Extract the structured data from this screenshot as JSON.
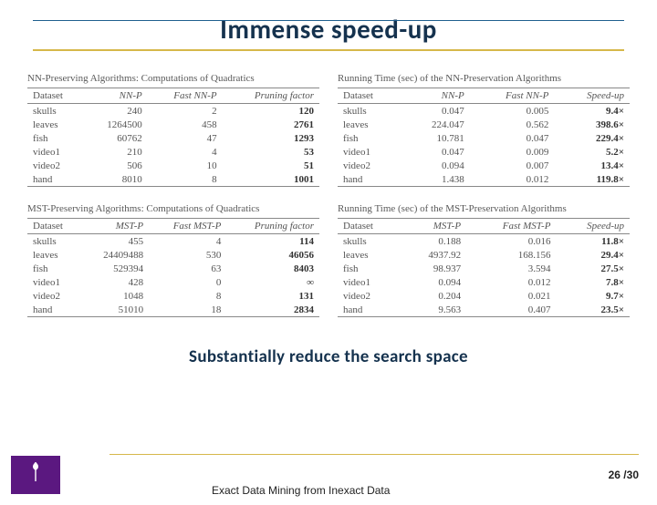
{
  "title": "Immense speed-up",
  "subtitle": "Substantially reduce the search space",
  "footer_title": "Exact Data Mining from Inexact Data",
  "pageno": "26 /30",
  "panels": {
    "nn_quad": {
      "title": "NN-Preserving Algorithms: Computations of Quadratics",
      "headers": [
        "Dataset",
        "NN-P",
        "Fast NN-P",
        "Pruning factor"
      ],
      "rows": [
        [
          "skulls",
          "240",
          "2",
          "120"
        ],
        [
          "leaves",
          "1264500",
          "458",
          "2761"
        ],
        [
          "fish",
          "60762",
          "47",
          "1293"
        ],
        [
          "video1",
          "210",
          "4",
          "53"
        ],
        [
          "video2",
          "506",
          "10",
          "51"
        ],
        [
          "hand",
          "8010",
          "8",
          "1001"
        ]
      ]
    },
    "nn_time": {
      "title": "Running Time (sec) of the NN-Preservation Algorithms",
      "headers": [
        "Dataset",
        "NN-P",
        "Fast NN-P",
        "Speed-up"
      ],
      "rows": [
        [
          "skulls",
          "0.047",
          "0.005",
          "9.4×"
        ],
        [
          "leaves",
          "224.047",
          "0.562",
          "398.6×"
        ],
        [
          "fish",
          "10.781",
          "0.047",
          "229.4×"
        ],
        [
          "video1",
          "0.047",
          "0.009",
          "5.2×"
        ],
        [
          "video2",
          "0.094",
          "0.007",
          "13.4×"
        ],
        [
          "hand",
          "1.438",
          "0.012",
          "119.8×"
        ]
      ]
    },
    "mst_quad": {
      "title": "MST-Preserving Algorithms: Computations of Quadratics",
      "headers": [
        "Dataset",
        "MST-P",
        "Fast MST-P",
        "Pruning factor"
      ],
      "rows": [
        [
          "skulls",
          "455",
          "4",
          "114"
        ],
        [
          "leaves",
          "24409488",
          "530",
          "46056"
        ],
        [
          "fish",
          "529394",
          "63",
          "8403"
        ],
        [
          "video1",
          "428",
          "0",
          "∞"
        ],
        [
          "video2",
          "1048",
          "8",
          "131"
        ],
        [
          "hand",
          "51010",
          "18",
          "2834"
        ]
      ]
    },
    "mst_time": {
      "title": "Running Time (sec) of the MST-Preservation Algorithms",
      "headers": [
        "Dataset",
        "MST-P",
        "Fast MST-P",
        "Speed-up"
      ],
      "rows": [
        [
          "skulls",
          "0.188",
          "0.016",
          "11.8×"
        ],
        [
          "leaves",
          "4937.92",
          "168.156",
          "29.4×"
        ],
        [
          "fish",
          "98.937",
          "3.594",
          "27.5×"
        ],
        [
          "video1",
          "0.094",
          "0.012",
          "7.8×"
        ],
        [
          "video2",
          "0.204",
          "0.021",
          "9.7×"
        ],
        [
          "hand",
          "9.563",
          "0.407",
          "23.5×"
        ]
      ]
    }
  },
  "chart_data": [
    {
      "type": "table",
      "title": "NN-Preserving Algorithms: Computations of Quadratics",
      "columns": [
        "Dataset",
        "NN-P",
        "Fast NN-P",
        "Pruning factor"
      ],
      "rows": [
        [
          "skulls",
          240,
          2,
          120
        ],
        [
          "leaves",
          1264500,
          458,
          2761
        ],
        [
          "fish",
          60762,
          47,
          1293
        ],
        [
          "video1",
          210,
          4,
          53
        ],
        [
          "video2",
          506,
          10,
          51
        ],
        [
          "hand",
          8010,
          8,
          1001
        ]
      ]
    },
    {
      "type": "table",
      "title": "Running Time (sec) of the NN-Preservation Algorithms",
      "columns": [
        "Dataset",
        "NN-P",
        "Fast NN-P",
        "Speed-up"
      ],
      "rows": [
        [
          "skulls",
          0.047,
          0.005,
          9.4
        ],
        [
          "leaves",
          224.047,
          0.562,
          398.6
        ],
        [
          "fish",
          10.781,
          0.047,
          229.4
        ],
        [
          "video1",
          0.047,
          0.009,
          5.2
        ],
        [
          "video2",
          0.094,
          0.007,
          13.4
        ],
        [
          "hand",
          1.438,
          0.012,
          119.8
        ]
      ]
    },
    {
      "type": "table",
      "title": "MST-Preserving Algorithms: Computations of Quadratics",
      "columns": [
        "Dataset",
        "MST-P",
        "Fast MST-P",
        "Pruning factor"
      ],
      "rows": [
        [
          "skulls",
          455,
          4,
          114
        ],
        [
          "leaves",
          24409488,
          530,
          46056
        ],
        [
          "fish",
          529394,
          63,
          8403
        ],
        [
          "video1",
          428,
          0,
          null
        ],
        [
          "video2",
          1048,
          8,
          131
        ],
        [
          "hand",
          51010,
          18,
          2834
        ]
      ]
    },
    {
      "type": "table",
      "title": "Running Time (sec) of the MST-Preservation Algorithms",
      "columns": [
        "Dataset",
        "MST-P",
        "Fast MST-P",
        "Speed-up"
      ],
      "rows": [
        [
          "skulls",
          0.188,
          0.016,
          11.8
        ],
        [
          "leaves",
          4937.92,
          168.156,
          29.4
        ],
        [
          "fish",
          98.937,
          3.594,
          27.5
        ],
        [
          "video1",
          0.094,
          0.012,
          7.8
        ],
        [
          "video2",
          0.204,
          0.021,
          9.7
        ],
        [
          "hand",
          9.563,
          0.407,
          23.5
        ]
      ]
    }
  ]
}
